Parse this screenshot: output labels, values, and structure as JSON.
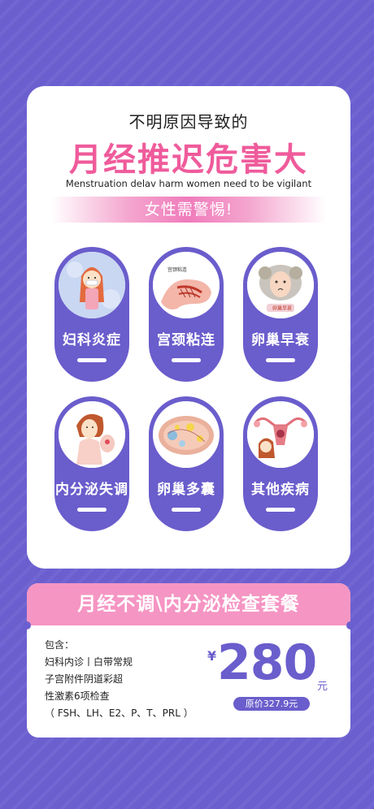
{
  "colors": {
    "background": "#6b5fd0",
    "accent_purple": "#6a5dcc",
    "accent_pink": "#ef5b9b",
    "header_pink": "#f595c3"
  },
  "header": {
    "subtitle": "不明原因导致的",
    "title": "月经推迟危害大",
    "english": "Menstruation delav harm women need to be vigilant",
    "warning": "女性需警惕!"
  },
  "conditions": [
    {
      "label": "妇科炎症",
      "icon": "girl-illustration"
    },
    {
      "label": "宫颈粘连",
      "icon": "cervix-illustration",
      "tag": "宫颈粘连"
    },
    {
      "label": "卵巢早衰",
      "icon": "ovary-illustration",
      "tag": "卵巢早衰"
    },
    {
      "label": "内分泌失调",
      "icon": "woman-illustration"
    },
    {
      "label": "卵巢多囊",
      "icon": "polycystic-ovary-illustration"
    },
    {
      "label": "其他疾病",
      "icon": "uterus-illustration"
    }
  ],
  "package": {
    "title": "月经不调\\内分泌检查套餐",
    "includes_label": "包含：",
    "items": [
      "妇科内诊丨白带常规",
      "子宫附件阴道彩超",
      "性激素6项检查",
      "（ FSH、LH、E2、P、T、PRL ）"
    ],
    "currency": "¥",
    "price": "280",
    "unit": "元",
    "original_price": "原价327.9元"
  }
}
